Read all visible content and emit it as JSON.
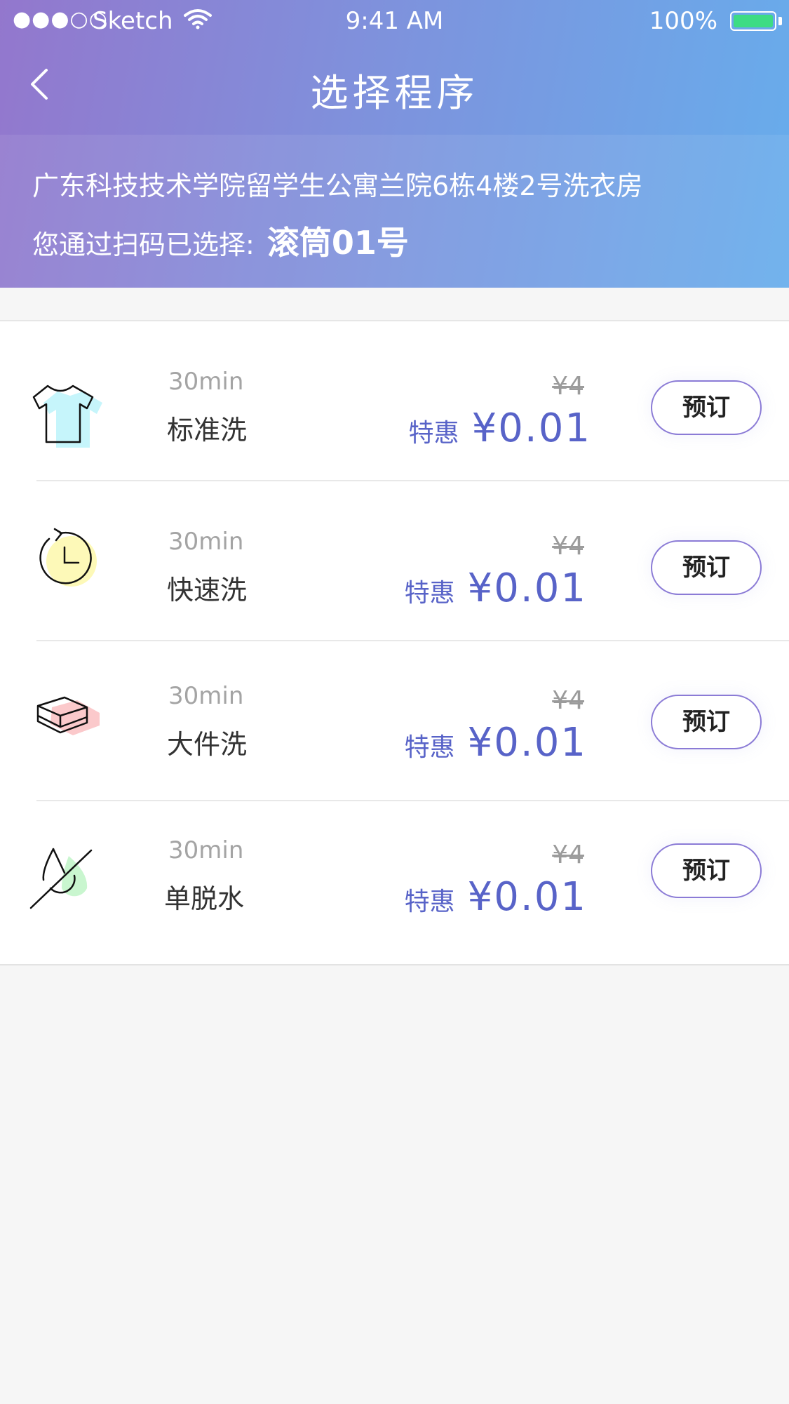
{
  "status_bar": {
    "signal": "●●●○○",
    "carrier": "Sketch",
    "time": "9:41 AM",
    "battery": "100%"
  },
  "nav": {
    "title": "选择程序"
  },
  "info": {
    "address": "广东科技技术学院留学生公寓兰院6栋4楼2号洗衣房",
    "scan_prefix": "您通过扫码已选择:",
    "machine": "滚筒01号"
  },
  "programs": [
    {
      "icon": "tshirt-icon",
      "duration": "30min",
      "name": "标准洗",
      "original_price": "¥4",
      "promo_tag": "特惠",
      "promo_price": "¥0.01",
      "button": "预订"
    },
    {
      "icon": "timer-icon",
      "duration": "30min",
      "name": "快速洗",
      "original_price": "¥4",
      "promo_tag": "特惠",
      "promo_price": "¥0.01",
      "button": "预订"
    },
    {
      "icon": "bedding-icon",
      "duration": "30min",
      "name": "大件洗",
      "original_price": "¥4",
      "promo_tag": "特惠",
      "promo_price": "¥0.01",
      "button": "预订"
    },
    {
      "icon": "spin-dry-icon",
      "duration": "30min",
      "name": "单脱水",
      "original_price": "¥4",
      "promo_tag": "特惠",
      "promo_price": "¥0.01",
      "button": "预订"
    }
  ],
  "colors": {
    "header_start": "#9377cd",
    "header_end": "#67adec",
    "promo": "#5863c8",
    "button_border": "#8b7bd6"
  }
}
